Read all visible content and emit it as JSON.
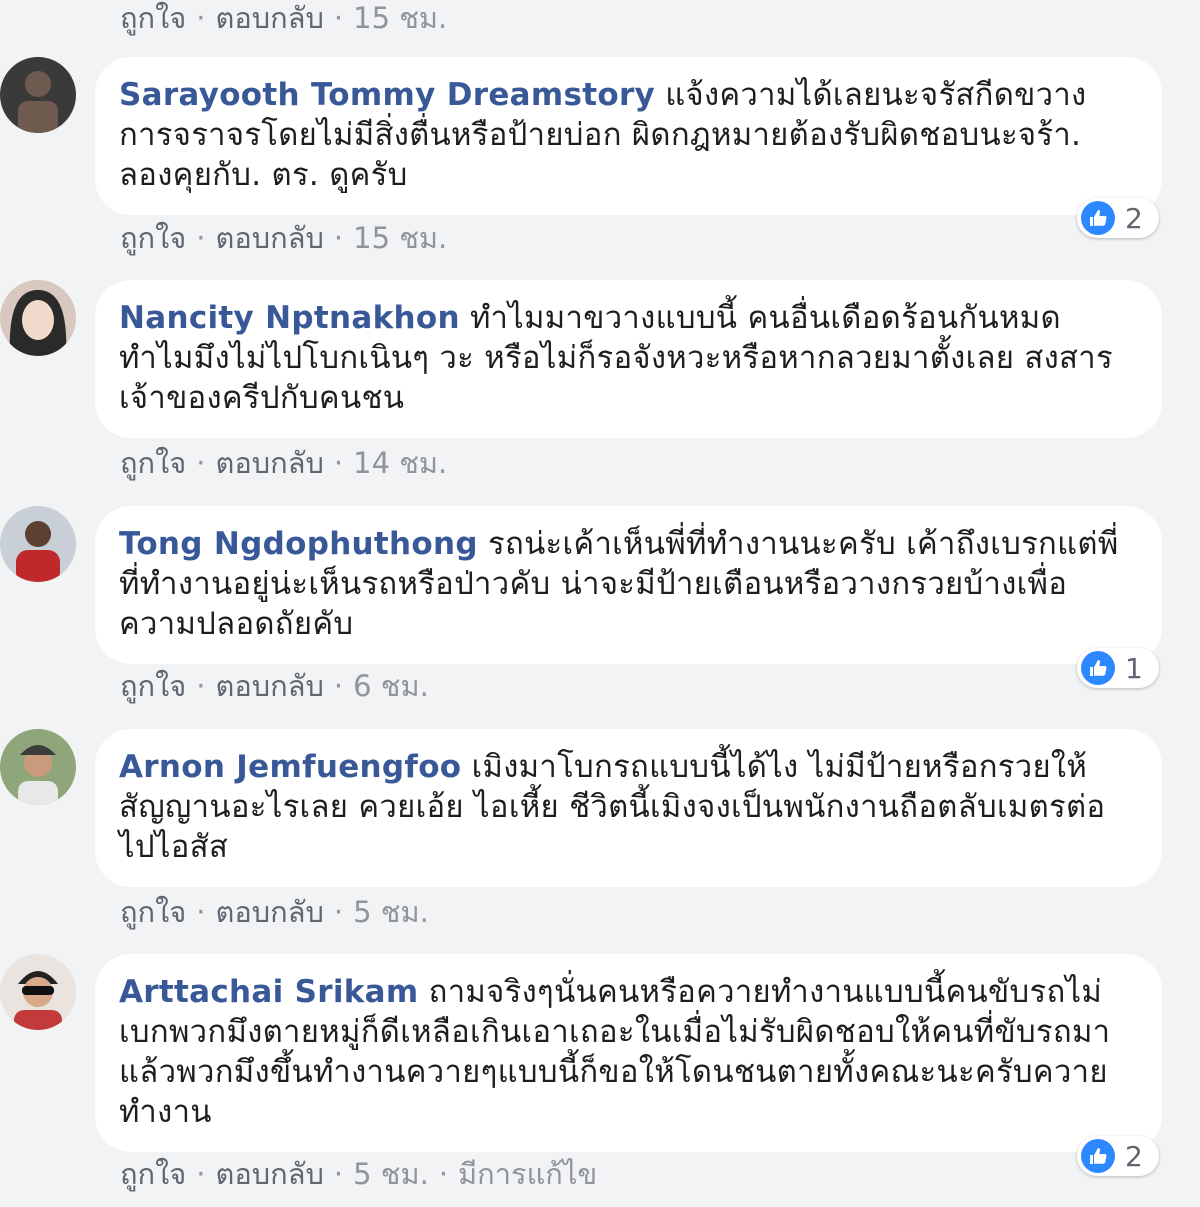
{
  "actions": {
    "like": "ถูกใจ",
    "reply": "ตอบกลับ",
    "separator": "·",
    "edited": "มีการแก้ไข"
  },
  "top_action_row": {
    "time": "15 ชม."
  },
  "comments": [
    {
      "author": "Sarayooth Tommy Dreamstory",
      "text": "แจ้งความได้เลยนะจรัสกีดขวางการจราจรโดยไม่มีสิ่งตื่นหรือป้ายบ่อก ผิดกฎหมายต้องรับผิดชอบนะจร้า. ลองคุยกับ. ตร. ดูครับ",
      "time": "15 ชม.",
      "reactions": "2",
      "avatar_colors": [
        "#3a3a3a",
        "#6e5a4e"
      ]
    },
    {
      "author": "Nancity Nptnakhon",
      "text": "ทำไมมาขวางแบบนี้ คนอื่นเดือดร้อนกันหมด ทำไมมึงไม่ไปโบกเนินๆ วะ หรือไม่ก็รอจังหวะหรือหากลวยมาตั้งเลย สงสารเจ้าของครีปกับคนชน",
      "time": "14 ชม.",
      "reactions": "",
      "avatar_colors": [
        "#d8c8c0",
        "#2a2a2a"
      ]
    },
    {
      "author": "Tong Ngdophuthong",
      "text": "รถน่ะเค้าเห็นพี่ที่ทำงานนะครับ เค้าถึงเบรกแต่พี่ที่ทำงานอยู่น่ะเห็นรถหรือป่าวคับ น่าจะมีป้ายเตือนหรือวางกรวยบ้างเพื่อความปลอดถัยคับ",
      "time": "6 ชม.",
      "reactions": "1",
      "avatar_colors": [
        "#c9cfd6",
        "#c0282c"
      ]
    },
    {
      "author": "Arnon Jemfuengfoo",
      "text": "เมิงมาโบกรถแบบนี้ได้ไง ไม่มีป้ายหรือกรวยให้สัญญานอะไรเลย ควยเอ้ย ไอเหี้ย ชีวิตนี้เมิงจงเป็นพนักงานถือตลับเมตรต่อไปไอสัส",
      "time": "5 ชม.",
      "reactions": "",
      "avatar_colors": [
        "#8fa57a",
        "#3c3c3c"
      ]
    },
    {
      "author": "Arttachai Srikam",
      "text": "ถามจริงๆนั่นคนหรือควายทำงานแบบนี้คนขับรถไม่เบกพวกมึงตายหมู่ก็ดีเหลือเกินเอาเถอะในเมื่อไม่รับผิดชอบให้คนที่ขับรถมาแล้วพวกมึงขึ้นทำงานควายๆแบบนี้ก็ขอให้โดนชนตายทั้งคณะนะครับควายทำงาน",
      "time": "5 ชม.",
      "reactions": "2",
      "avatar_colors": [
        "#e9e4e0",
        "#c23a3a"
      ],
      "edited": true
    }
  ]
}
